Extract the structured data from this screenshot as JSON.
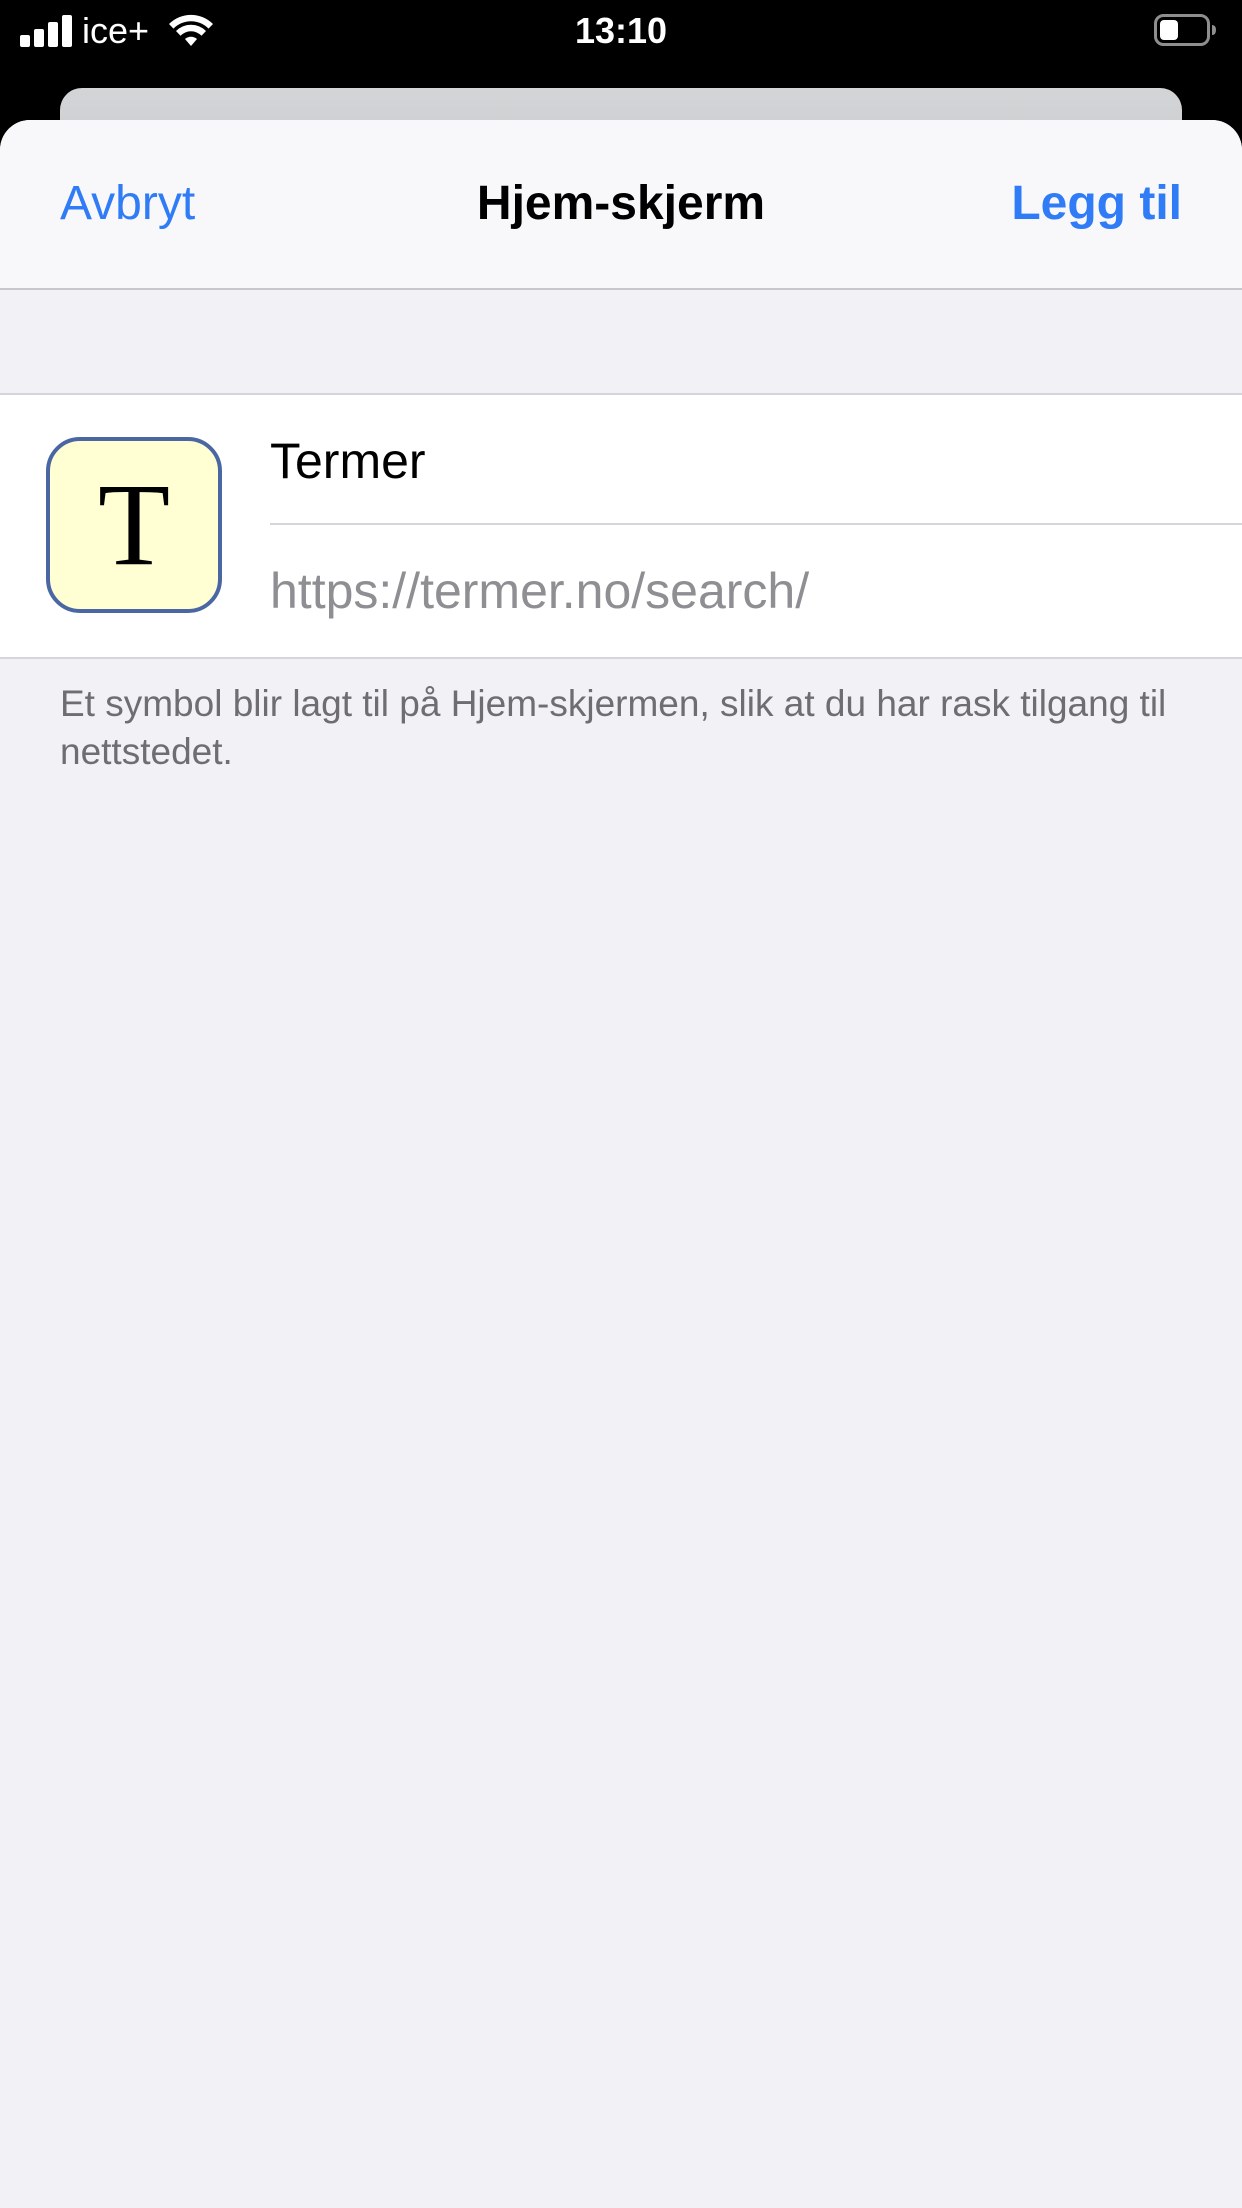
{
  "status_bar": {
    "carrier": "ice+",
    "time": "13:10",
    "battery_level": 0.4
  },
  "nav": {
    "cancel_label": "Avbryt",
    "title": "Hjem-skjerm",
    "add_label": "Legg til"
  },
  "bookmark": {
    "icon_letter": "T",
    "icon_background": "#ffffd3",
    "icon_border": "#4a67a3",
    "name": "Termer",
    "url": "https://termer.no/search/"
  },
  "footer": {
    "note": "Et symbol blir lagt til på Hjem-skjermen, slik at du har rask tilgang til nettstedet."
  },
  "colors": {
    "accent": "#2f7cf6",
    "background": "#f1f1f6"
  }
}
